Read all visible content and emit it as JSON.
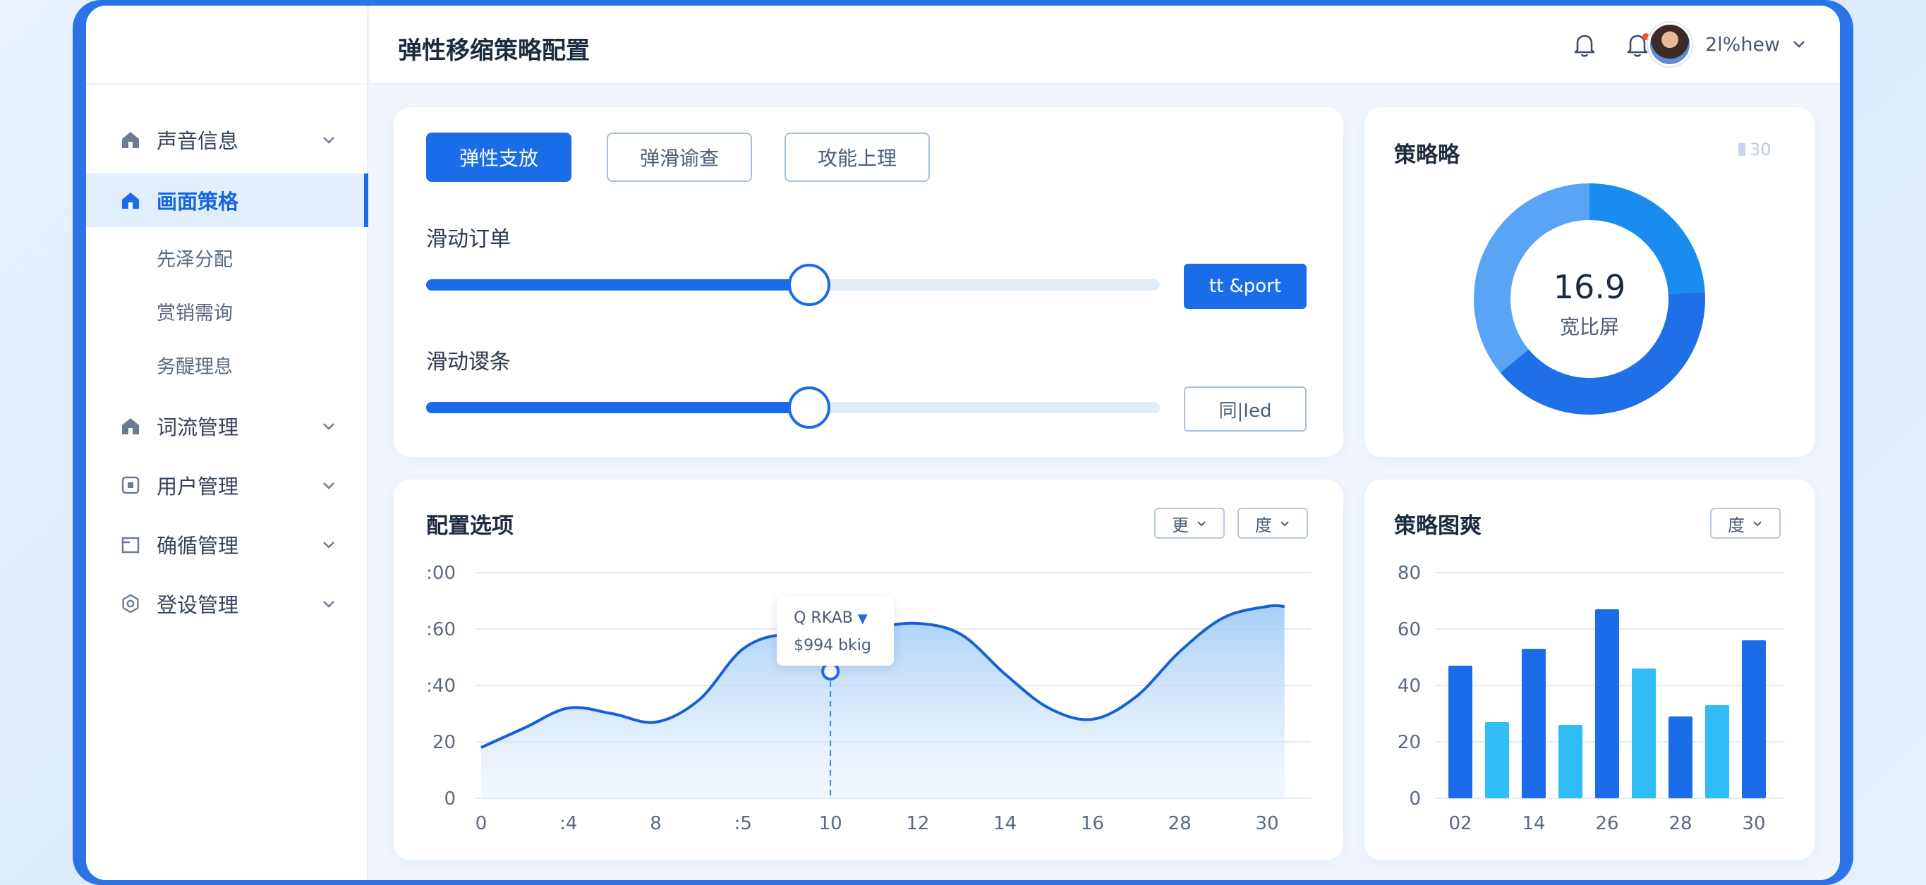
{
  "header": {
    "title": "弹性移缩策略配置",
    "user_name": "2l%hew"
  },
  "sidebar": {
    "items": [
      {
        "label": "声音信息",
        "icon": "home-icon",
        "has_chevron": true
      },
      {
        "label": "画面策格",
        "icon": "home-icon",
        "active": true
      },
      {
        "label": "词流管理",
        "icon": "home-icon",
        "has_chevron": true
      },
      {
        "label": "用户管理",
        "icon": "square-icon",
        "has_chevron": true
      },
      {
        "label": "确循管理",
        "icon": "folder-icon",
        "has_chevron": true
      },
      {
        "label": "登设管理",
        "icon": "hexagon-gear-icon",
        "has_chevron": true
      }
    ],
    "sub_items": [
      "先泽分配",
      "赏销需询",
      "务醍理息"
    ]
  },
  "controls": {
    "tabs": [
      "弹性支放",
      "弹滑谕查",
      "攻能上理"
    ],
    "slider1": {
      "label": "滑动订单",
      "value": 0.52,
      "button": "tt &port"
    },
    "slider2": {
      "label": "滑动谡条",
      "value": 0.52,
      "button": "同|Ied"
    }
  },
  "donut": {
    "title": "策略略",
    "corner": "30",
    "value": "16.9",
    "caption": "宽比屏",
    "segments": [
      {
        "fraction": 0.24,
        "color": "#1a8cf0"
      },
      {
        "fraction": 0.4,
        "color": "#1f6fe6"
      },
      {
        "fraction": 0.36,
        "color": "#5aa4f5"
      }
    ]
  },
  "line_card": {
    "title": "配置选项",
    "dropdowns": [
      "更",
      "度"
    ],
    "tooltip": {
      "line1": "Q RKAB",
      "line2": "$994 bkig"
    }
  },
  "bar_card": {
    "title": "策略图爽",
    "dropdown": "度"
  },
  "colors": {
    "accent": "#1a6ce8",
    "bar_dark": "#1a6ce8",
    "bar_light": "#30bdf5",
    "line": "#1560d6"
  },
  "chart_data": [
    {
      "type": "area",
      "x_tick_labels": [
        "0",
        ":4",
        "8",
        ":5",
        "10",
        "12",
        "14",
        "16",
        "28",
        "30"
      ],
      "y_tick_labels": [
        "0",
        "20",
        ":40",
        ":60",
        ":00"
      ],
      "ylim": [
        0,
        80
      ],
      "points": [
        [
          0,
          18
        ],
        [
          0.5,
          25
        ],
        [
          1,
          32
        ],
        [
          1.5,
          30
        ],
        [
          2,
          27
        ],
        [
          2.5,
          35
        ],
        [
          3,
          53
        ],
        [
          3.5,
          58
        ],
        [
          4,
          54
        ],
        [
          4.5,
          60
        ],
        [
          5,
          62
        ],
        [
          5.5,
          58
        ],
        [
          6,
          44
        ],
        [
          6.5,
          32
        ],
        [
          7,
          28
        ],
        [
          7.5,
          36
        ],
        [
          8,
          52
        ],
        [
          8.5,
          64
        ],
        [
          9,
          68
        ],
        [
          9.2,
          68
        ]
      ],
      "marker_x": 4,
      "marker_y": 45
    },
    {
      "type": "bar",
      "categories": [
        "02",
        "14",
        "26",
        "28",
        "30"
      ],
      "series": [
        {
          "values": [
            47,
            53,
            67,
            29,
            56
          ]
        },
        {
          "values": [
            27,
            26,
            46,
            33
          ]
        }
      ],
      "y_tick_labels": [
        "0",
        "20",
        "40",
        "60",
        "80"
      ],
      "ylim": [
        0,
        80
      ]
    }
  ]
}
